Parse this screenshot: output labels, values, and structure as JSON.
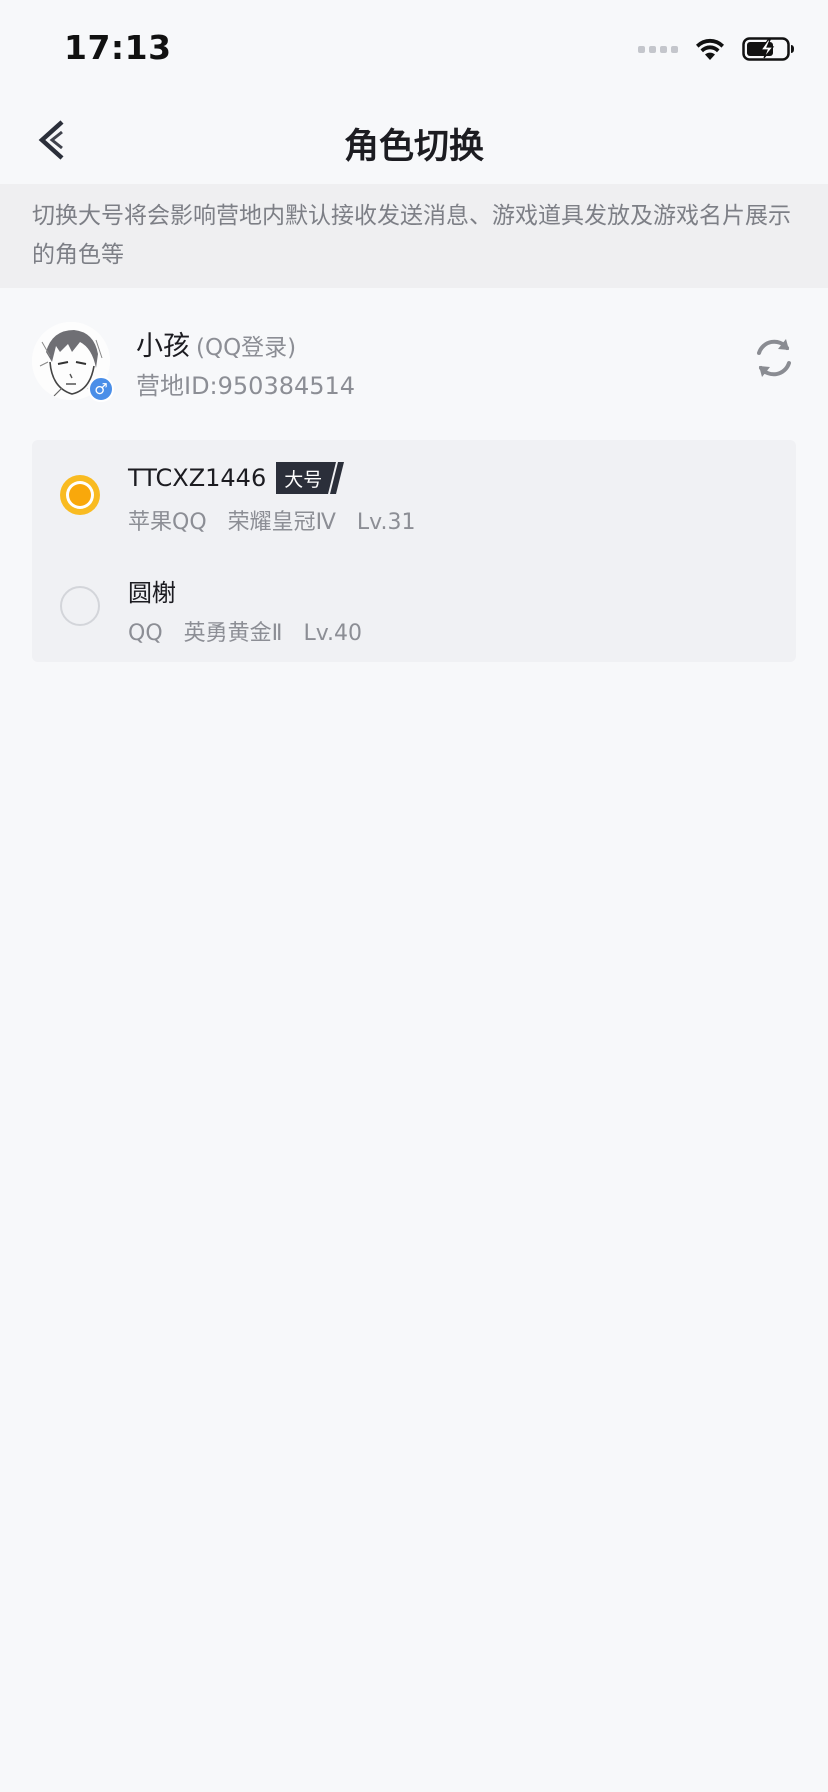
{
  "status_bar": {
    "time": "17:13"
  },
  "nav": {
    "title": "角色切换"
  },
  "notice": {
    "text": "切换大号将会影响营地内默认接收发送消息、游戏道具发放及游戏名片展示的角色等"
  },
  "profile": {
    "name": "小孩",
    "login": "(QQ登录)",
    "camp_id": "营地ID:950384514",
    "gender_symbol": "♂"
  },
  "roles": [
    {
      "name": "TTCXZ1446",
      "tag": "大号",
      "platform": "苹果QQ",
      "rank": "荣耀皇冠Ⅳ",
      "level": "Lv.31",
      "selected": true
    },
    {
      "name": "圆榭",
      "tag": "",
      "platform": "QQ",
      "rank": "英勇黄金Ⅱ",
      "level": "Lv.40",
      "selected": false
    }
  ],
  "colors": {
    "accent": "#f9a80b",
    "background": "#f7f8fa",
    "notice_bg": "#efeff1",
    "tag_bg": "#2b2f3a"
  }
}
